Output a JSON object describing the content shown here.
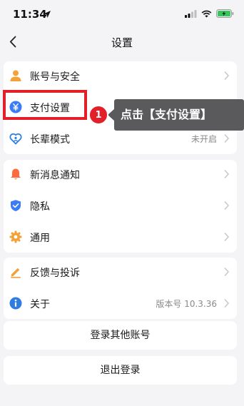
{
  "status_bar": {
    "time": "11:34",
    "icons": [
      "location-arrow-icon",
      "signal-icon",
      "wifi-icon",
      "battery-charging-icon"
    ]
  },
  "nav": {
    "title": "设置",
    "back_icon": "chevron-left-icon"
  },
  "groups": [
    {
      "items": [
        {
          "label": "账号与安全",
          "value": "",
          "icon": "user-icon",
          "icon_color": "#f1a33a"
        },
        {
          "label": "支付设置",
          "value": "",
          "icon": "yuan-coin-icon",
          "icon_color": "#3a7bf6"
        },
        {
          "label": "长辈模式",
          "value": "未开启",
          "icon": "heart-person-icon",
          "icon_color": "#2f7de1"
        }
      ]
    },
    {
      "items": [
        {
          "label": "新消息通知",
          "value": "",
          "icon": "bell-icon",
          "icon_color": "#ff6a3d"
        },
        {
          "label": "隐私",
          "value": "",
          "icon": "shield-icon",
          "icon_color": "#3a7bf6"
        },
        {
          "label": "通用",
          "value": "",
          "icon": "gear-icon",
          "icon_color": "#f1a33a"
        }
      ]
    },
    {
      "items": [
        {
          "label": "反馈与投诉",
          "value": "",
          "icon": "pencil-icon",
          "icon_color": "#f1a33a"
        },
        {
          "label": "关于",
          "value": "版本号 10.3.36",
          "icon": "info-icon",
          "icon_color": "#2f7de1"
        }
      ]
    }
  ],
  "buttons": {
    "login_other": "登录其他账号",
    "logout": "退出登录"
  },
  "annotation": {
    "step": "1",
    "text": "点击【支付设置】",
    "color": "#e3202a"
  }
}
